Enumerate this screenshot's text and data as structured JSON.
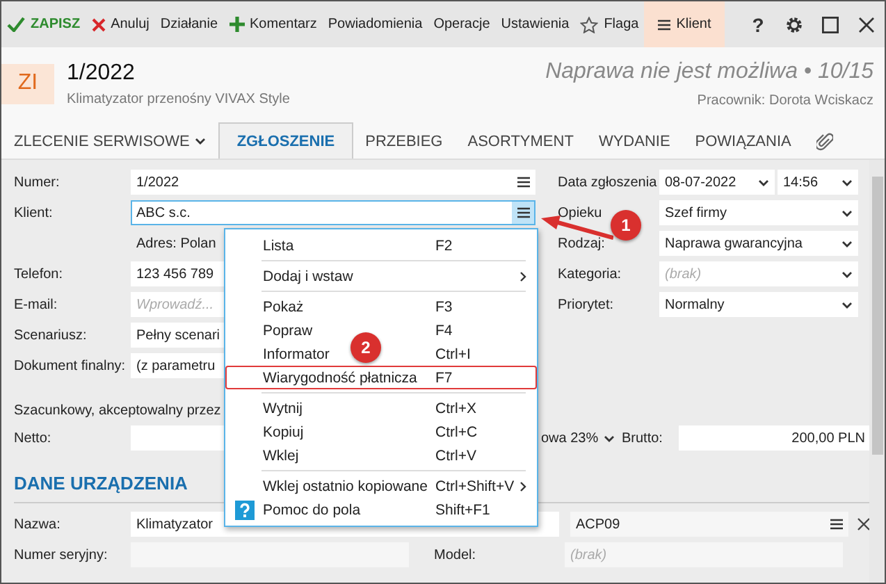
{
  "toolbar": {
    "items": [
      {
        "label": "ZAPISZ",
        "kind": "save",
        "active": false
      },
      {
        "label": "Anuluj",
        "kind": "cancel",
        "active": false
      },
      {
        "label": "Działanie",
        "kind": "plain",
        "active": false
      },
      {
        "label": "Komentarz",
        "kind": "add",
        "active": false
      },
      {
        "label": "Powiadomienia",
        "kind": "plain",
        "active": false
      },
      {
        "label": "Operacje",
        "kind": "plain",
        "active": false
      },
      {
        "label": "Ustawienia",
        "kind": "plain",
        "active": false
      },
      {
        "label": "Flaga",
        "kind": "flag",
        "active": false
      },
      {
        "label": "Klient",
        "kind": "panel",
        "active": true
      }
    ],
    "help": "?"
  },
  "header": {
    "badge": "ZI",
    "title": "1/2022",
    "subtitle": "Klimatyzator przenośny VIVAX Style",
    "status": "Naprawa nie jest możliwa • 10/15",
    "employee": "Pracownik: Dorota Wciskacz"
  },
  "tabs": [
    {
      "label": "ZLECENIE SERWISOWE",
      "kind": "dropdown",
      "selected": false
    },
    {
      "label": "ZGŁOSZENIE",
      "kind": "tab",
      "selected": true
    },
    {
      "label": "PRZEBIEG",
      "kind": "tab",
      "selected": false
    },
    {
      "label": "ASORTYMENT",
      "kind": "tab",
      "selected": false
    },
    {
      "label": "WYDANIE",
      "kind": "tab",
      "selected": false
    },
    {
      "label": "POWIĄZANIA",
      "kind": "tab",
      "selected": false
    },
    {
      "kind": "attachment",
      "selected": false
    }
  ],
  "left_fields": [
    {
      "label": "Numer:",
      "value": "1/2022",
      "kind": "lookup",
      "focused": false
    },
    {
      "label": "Klient:",
      "value": "ABC s.c.",
      "kind": "lookup",
      "focused": true
    },
    {
      "label": "Adres:",
      "value": "Polan",
      "kind": "address"
    },
    {
      "label": "Telefon:",
      "value": "123 456 789",
      "kind": "text",
      "focused": false
    },
    {
      "label": "E-mail:",
      "placeholder": "Wprowadź...",
      "kind": "text",
      "focused": false
    },
    {
      "label": "Scenariusz:",
      "value": "Pełny scenari",
      "kind": "text",
      "focused": false
    },
    {
      "label": "Dokument finalny:",
      "value": "(z parametru",
      "kind": "text",
      "focused": false
    }
  ],
  "right_fields": [
    {
      "label": "Data zgłoszenia",
      "value": "08-07-2022",
      "time": "14:56",
      "kind": "datetime"
    },
    {
      "label": "Opieku",
      "value": "Szef firmy",
      "kind": "select"
    },
    {
      "label": "Rodzaj:",
      "value": "Naprawa gwarancyjna",
      "kind": "select"
    },
    {
      "label": "Kategoria:",
      "placeholder": "(brak)",
      "kind": "select"
    },
    {
      "label": "Priorytet:",
      "value": "Normalny",
      "kind": "select"
    }
  ],
  "price": {
    "caption": "Szacunkowy, akceptowalny przez",
    "net_label": "Netto:",
    "vat": "owa 23%",
    "gross_label": "Brutto:",
    "gross": "200,00 PLN"
  },
  "device": {
    "heading": "DANE URZĄDZENIA",
    "name_label": "Nazwa:",
    "name": "Klimatyzator",
    "code": "ACP09",
    "serial_label": "Numer seryjny:",
    "model_label": "Model:",
    "model_placeholder": "(brak)"
  },
  "context_menu": [
    {
      "label": "Lista",
      "shortcut": "F2",
      "submenu": false,
      "highlighted": false,
      "kind": "item"
    },
    {
      "kind": "separator"
    },
    {
      "label": "Dodaj i wstaw",
      "submenu": true,
      "highlighted": false,
      "kind": "item"
    },
    {
      "kind": "separator"
    },
    {
      "label": "Pokaż",
      "shortcut": "F3",
      "submenu": false,
      "highlighted": false,
      "kind": "item"
    },
    {
      "label": "Popraw",
      "shortcut": "F4",
      "submenu": false,
      "highlighted": false,
      "kind": "item"
    },
    {
      "label": "Informator",
      "shortcut": "Ctrl+I",
      "submenu": false,
      "highlighted": false,
      "kind": "item"
    },
    {
      "label": "Wiarygodność płatnicza",
      "shortcut": "F7",
      "submenu": false,
      "highlighted": true,
      "kind": "item"
    },
    {
      "kind": "separator"
    },
    {
      "label": "Wytnij",
      "shortcut": "Ctrl+X",
      "submenu": false,
      "highlighted": false,
      "kind": "item"
    },
    {
      "label": "Kopiuj",
      "shortcut": "Ctrl+C",
      "submenu": false,
      "highlighted": false,
      "kind": "item"
    },
    {
      "label": "Wklej",
      "shortcut": "Ctrl+V",
      "submenu": false,
      "highlighted": false,
      "kind": "item"
    },
    {
      "kind": "separator"
    },
    {
      "label": "Wklej ostatnio kopiowane",
      "shortcut": "Ctrl+Shift+V",
      "submenu": true,
      "highlighted": false,
      "kind": "item"
    },
    {
      "label": "Pomoc do pola",
      "shortcut": "Shift+F1",
      "submenu": false,
      "highlighted": false,
      "kind": "help"
    }
  ],
  "callouts": [
    {
      "label": "1",
      "kind": "arrow"
    },
    {
      "label": "2",
      "kind": "badge"
    }
  ]
}
